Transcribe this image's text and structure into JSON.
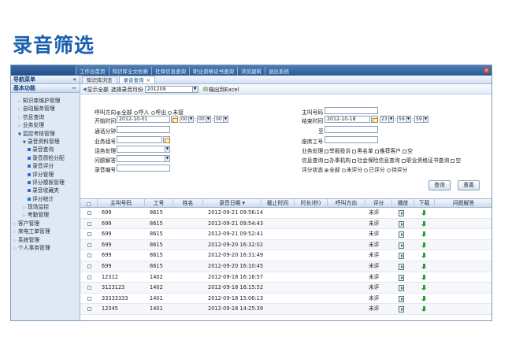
{
  "slide_title": "录音筛选",
  "topbar": {
    "nav": [
      "工作台首页",
      "知识库全文检索",
      "社保信息查询",
      "职业资格证书查询",
      "浏览建筑",
      "退出系统"
    ]
  },
  "sidebar": {
    "header": "导航菜单",
    "header_ctl": "«",
    "section": "基本功能",
    "section_ctl": "−",
    "items": [
      {
        "label": "知识库维护管理",
        "level": 1,
        "icon": "tri"
      },
      {
        "label": "自动服务管理",
        "level": 1,
        "icon": "tri"
      },
      {
        "label": "信息查询",
        "level": 1,
        "icon": "tri"
      },
      {
        "label": "业务处理",
        "level": 1,
        "icon": "tri"
      },
      {
        "label": "监控考核管理",
        "level": 1,
        "icon": "tri-open"
      },
      {
        "label": "录音资料管理",
        "level": 2,
        "icon": "tri-open"
      },
      {
        "label": "录音查询",
        "level": 3,
        "icon": "sq"
      },
      {
        "label": "录音质检分配",
        "level": 3,
        "icon": "sq"
      },
      {
        "label": "录音评分",
        "level": 3,
        "icon": "sq"
      },
      {
        "label": "评分管理",
        "level": 3,
        "icon": "sq"
      },
      {
        "label": "评分模板管理",
        "level": 3,
        "icon": "sq"
      },
      {
        "label": "录音收藏夹",
        "level": 3,
        "icon": "sq"
      },
      {
        "label": "评分统计",
        "level": 3,
        "icon": "sq"
      },
      {
        "label": "现场监控",
        "level": 2,
        "icon": "tri"
      },
      {
        "label": "考勤管理",
        "level": 2,
        "icon": "tri"
      },
      {
        "label": "客户管理",
        "level": 0,
        "icon": "tri"
      },
      {
        "label": "来电工单管理",
        "level": 0,
        "icon": "tri"
      },
      {
        "label": "系统管理",
        "level": 0,
        "icon": "tri"
      },
      {
        "label": "个人事务管理",
        "level": 0,
        "icon": "tri"
      }
    ]
  },
  "tabs": [
    {
      "label": "知识库浏览",
      "active": false
    },
    {
      "label": "录音查询",
      "active": true,
      "close": "×"
    }
  ],
  "toolbar": {
    "show_all": "显示全部",
    "month_label": "选择录音月份",
    "month_value": "201209",
    "export": "输出到Excel"
  },
  "form": {
    "direction_label": "呼叫方向",
    "direction_options": [
      "全部",
      "呼入",
      "呼出",
      "未接"
    ],
    "start_label": "开始时间",
    "start_date": "2012-10-01",
    "start_h": "00",
    "start_m": "00",
    "start_s": "00",
    "caller_label": "通话分钟",
    "caller_value": "",
    "agent_label": "业务组号",
    "agent_value": "",
    "service_label": "话务处理",
    "service_value": "",
    "issue_label": "问题解答",
    "issue_value": "",
    "rec_label": "录音编号",
    "rec_value": "",
    "main_no_label": "主叫号码",
    "main_no_value": "",
    "end_label": "结束时间",
    "end_date": "2012-10-18",
    "end_h": "23",
    "end_m": "59",
    "end_s": "59",
    "to_label": "至",
    "to_value": "",
    "seat_label": "座席工号",
    "seat_value": "",
    "biz_label": "业务处理",
    "biz_options": [
      "举报投诉",
      "黑名单",
      "推荐客户",
      "空"
    ],
    "info_label": "信息查询",
    "info_options": [
      "办事机构",
      "社会保险信息查询",
      "职业资格证书查询",
      "空"
    ],
    "score_label": "评分状态",
    "score_options": [
      "全部",
      "未评分",
      "已评分",
      "待评分"
    ],
    "query_button": "查询",
    "reset_button": "重置"
  },
  "grid": {
    "headers": [
      "",
      "主叫号码",
      "工号",
      "姓名",
      "录音日期 ▾",
      "截止时间",
      "时长(秒)",
      "呼叫方向",
      "评分",
      "播放",
      "下载",
      "问题解答"
    ],
    "rows": [
      {
        "caller": "699",
        "agent": "8615",
        "name": "",
        "date": "2012-09-21 09:56:14",
        "score": "未评"
      },
      {
        "caller": "699",
        "agent": "8615",
        "name": "",
        "date": "2012-09-21 09:54:43",
        "score": "未评"
      },
      {
        "caller": "699",
        "agent": "8615",
        "name": "",
        "date": "2012-09-21 09:52:41",
        "score": "未评"
      },
      {
        "caller": "699",
        "agent": "8615",
        "name": "",
        "date": "2012-09-20 16:32:02",
        "score": "未评"
      },
      {
        "caller": "699",
        "agent": "8615",
        "name": "",
        "date": "2012-09-20 16:31:49",
        "score": "未评"
      },
      {
        "caller": "699",
        "agent": "8615",
        "name": "",
        "date": "2012-09-20 16:10:45",
        "score": "未评"
      },
      {
        "caller": "12312",
        "agent": "1402",
        "name": "",
        "date": "2012-09-18 16:16:57",
        "score": "未评"
      },
      {
        "caller": "3123123",
        "agent": "1402",
        "name": "",
        "date": "2012-09-18 16:15:52",
        "score": "未评"
      },
      {
        "caller": "33333333",
        "agent": "1401",
        "name": "",
        "date": "2012-09-18 15:06:13",
        "score": "未评"
      },
      {
        "caller": "12345",
        "agent": "1401",
        "name": "",
        "date": "2012-09-18 14:25:39",
        "score": "未评"
      }
    ]
  }
}
